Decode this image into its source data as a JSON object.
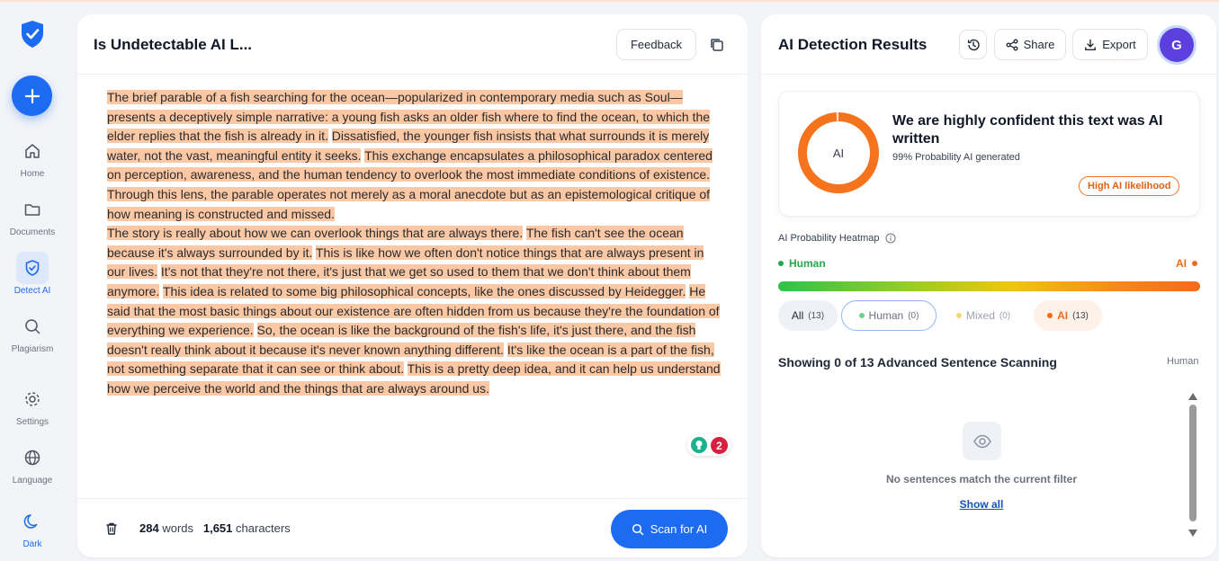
{
  "sidebar": {
    "items": [
      {
        "label": "Home",
        "icon": "home-icon"
      },
      {
        "label": "Documents",
        "icon": "folder-icon"
      },
      {
        "label": "Detect AI",
        "icon": "shield-check-icon"
      },
      {
        "label": "Plagiarism",
        "icon": "search-icon"
      },
      {
        "label": "Settings",
        "icon": "gear-icon"
      },
      {
        "label": "Language",
        "icon": "globe-icon"
      },
      {
        "label": "Dark",
        "icon": "moon-icon"
      }
    ],
    "active": "Detect AI"
  },
  "editor": {
    "title": "Is Undetectable AI L...",
    "feedback_label": "Feedback",
    "segments": [
      {
        "t": "The brief parable of a fish searching for the ocean—popularized in contemporary media such as Soul—presents a deceptively simple narrative: a young fish asks an older fish where to find the ocean, to which the elder replies that the fish is already in it.",
        "hl": true
      },
      {
        "t": " ",
        "hl": false
      },
      {
        "t": "Dissatisfied, the younger fish insists that what surrounds it is merely water, not the vast, meaningful entity it seeks.",
        "hl": true
      },
      {
        "t": " ",
        "hl": false
      },
      {
        "t": "This exchange encapsulates a philosophical paradox centered on perception, awareness, and the human tendency to overlook the most immediate conditions of existence.",
        "hl": true
      },
      {
        "t": " ",
        "hl": false
      },
      {
        "t": "Through this lens, the parable operates not merely as a moral anecdote but as an epistemological critique of how meaning is constructed and missed.",
        "hl": true
      },
      {
        "t": "\n",
        "hl": false
      },
      {
        "t": "The story is really about how we can overlook things that are always there.",
        "hl": true
      },
      {
        "t": " ",
        "hl": false
      },
      {
        "t": "The fish can't see the ocean because it's always surrounded by it.",
        "hl": true
      },
      {
        "t": " ",
        "hl": false
      },
      {
        "t": "This is like how we often don't notice things that are always present in our lives.",
        "hl": true
      },
      {
        "t": " ",
        "hl": false
      },
      {
        "t": "It's not that they're not there, it's just that we get so used to them that we don't think about them anymore.",
        "hl": true
      },
      {
        "t": " ",
        "hl": false
      },
      {
        "t": "This idea is related to some big philosophical concepts, like the ones discussed by Heidegger.",
        "hl": true
      },
      {
        "t": " ",
        "hl": false
      },
      {
        "t": "He said that the most basic things about our existence are often hidden from us because they're the foundation of everything we experience.",
        "hl": true
      },
      {
        "t": " ",
        "hl": false
      },
      {
        "t": "So, the ocean is like the background of the fish's life, it's just there, and the fish doesn't really think about it because it's never known anything different.",
        "hl": true
      },
      {
        "t": " ",
        "hl": false
      },
      {
        "t": "It's like the ocean is a part of the fish, not something separate that it can see or think about.",
        "hl": true
      },
      {
        "t": " ",
        "hl": false
      },
      {
        "t": "This is a pretty deep idea, and it can help us understand how we perceive the world and the things that are always around us.",
        "hl": true
      }
    ],
    "badge_count": "2",
    "word_count": "284",
    "word_label": "words",
    "char_count": "1,651",
    "char_label": "characters",
    "scan_label": "Scan for AI"
  },
  "results": {
    "title": "AI Detection Results",
    "share_label": "Share",
    "export_label": "Export",
    "avatar_initial": "G",
    "verdict": {
      "ring_label": "AI",
      "ai_fraction": 0.99,
      "title": "We are highly confident this text was AI written",
      "subtitle": "99% Probability AI generated",
      "badge": "High AI likelihood"
    },
    "heatmap": {
      "title": "AI Probability Heatmap",
      "left_label": "Human",
      "right_label": "AI"
    },
    "filters": [
      {
        "label": "All",
        "count": "(13)"
      },
      {
        "label": "Human",
        "count": "(0)"
      },
      {
        "label": "Mixed",
        "count": "(0)"
      },
      {
        "label": "AI",
        "count": "(13)"
      }
    ],
    "showing_title": "Showing 0 of 13 Advanced Sentence Scanning",
    "showing_filter": "Human",
    "empty_message": "No sentences match the current filter",
    "show_all_label": "Show all"
  },
  "colors": {
    "accent": "#1d6bf0",
    "highlight": "#fbc8a6",
    "ai_orange": "#f26a1b",
    "human_green": "#22a84b"
  }
}
